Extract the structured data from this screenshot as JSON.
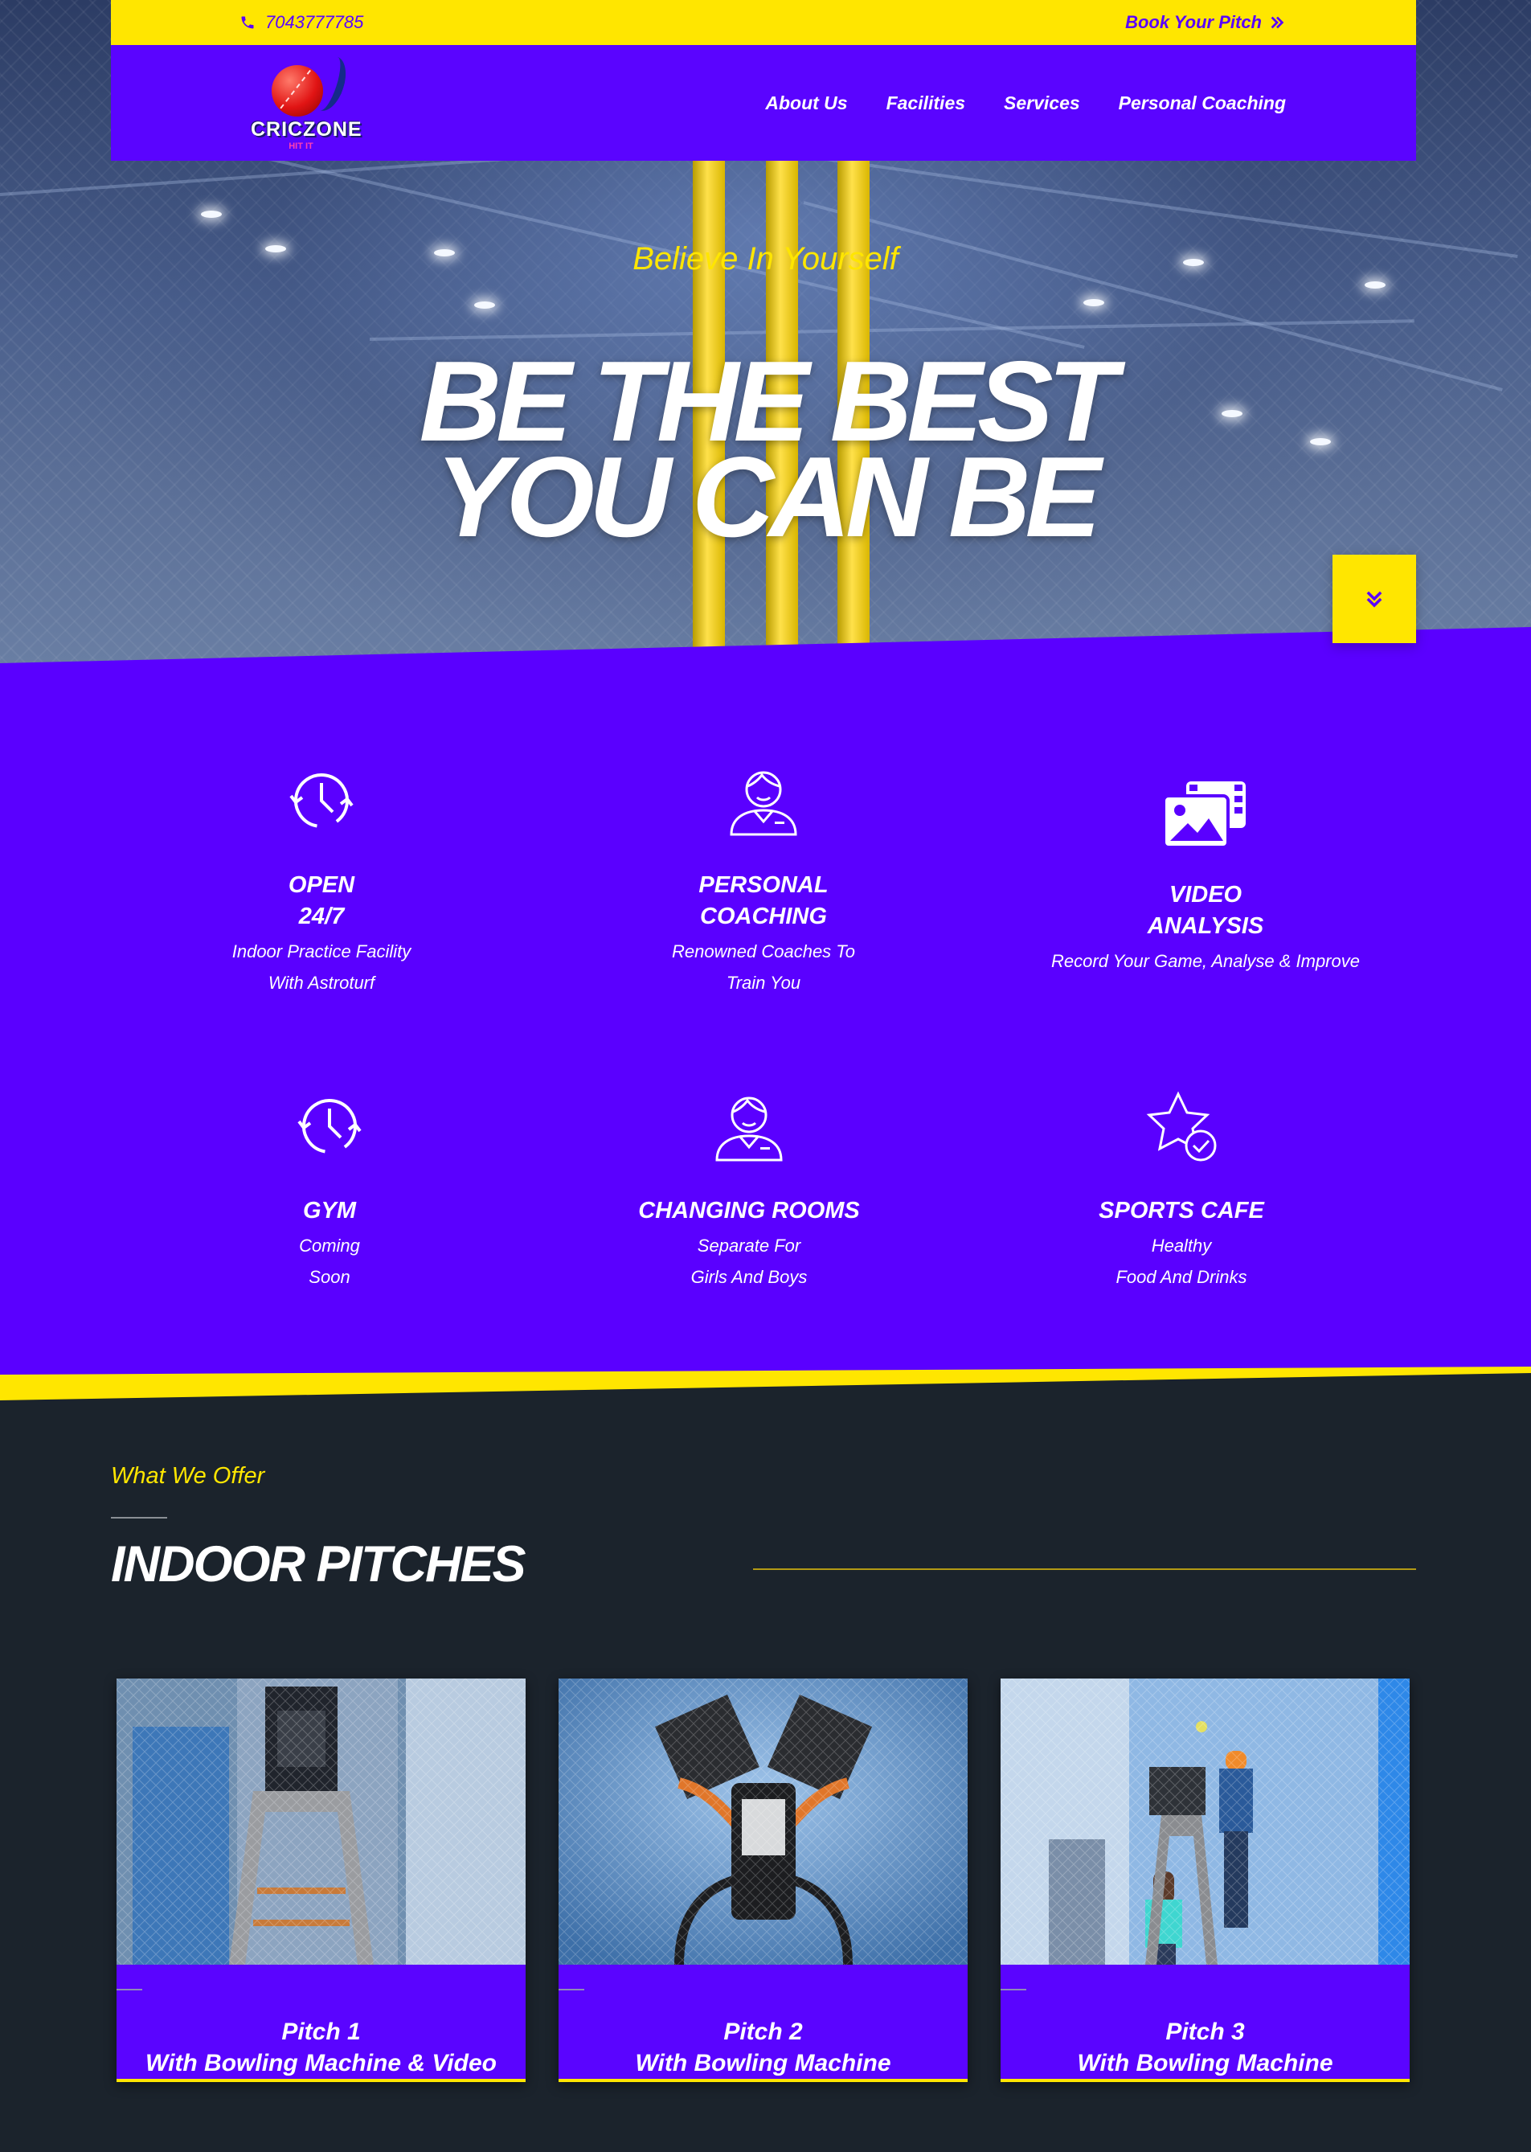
{
  "topbar": {
    "phone": "7043777785",
    "book": "Book Your Pitch"
  },
  "brand": {
    "name": "CRICZONE",
    "tagline": "HIT IT"
  },
  "nav": {
    "items": [
      "About Us",
      "Facilities",
      "Services",
      "Personal Coaching"
    ]
  },
  "hero": {
    "tagline": "Believe In Yourself",
    "headline_line1": "BE THE BEST",
    "headline_line2": "YOU CAN BE"
  },
  "features": [
    {
      "title": "OPEN\n24/7",
      "desc": "Indoor Practice Facility\nWith Astroturf",
      "icon": "clock-refresh-icon"
    },
    {
      "title": "PERSONAL\nCOACHING",
      "desc": "Renowned Coaches To\nTrain You",
      "icon": "coach-icon"
    },
    {
      "title": "VIDEO\nANALYSIS",
      "desc": "Record Your Game, Analyse & Improve",
      "icon": "video-gallery-icon"
    },
    {
      "title": "GYM",
      "desc": "Coming\nSoon",
      "icon": "clock-refresh-icon"
    },
    {
      "title": "CHANGING ROOMS",
      "desc": "Separate For\nGirls And Boys",
      "icon": "person-icon"
    },
    {
      "title": "SPORTS CAFE",
      "desc": "Healthy\nFood And Drinks",
      "icon": "star-check-icon"
    }
  ],
  "offer": {
    "kicker": "What We Offer",
    "title": "INDOOR PITCHES"
  },
  "pitches": [
    {
      "title": "Pitch 1\nWith Bowling Machine & Video"
    },
    {
      "title": "Pitch 2\nWith Bowling Machine"
    },
    {
      "title": "Pitch 3\nWith Bowling Machine"
    }
  ],
  "colors": {
    "purple": "#5a04ff",
    "yellow": "#ffe600",
    "dark": "#1b232c"
  }
}
